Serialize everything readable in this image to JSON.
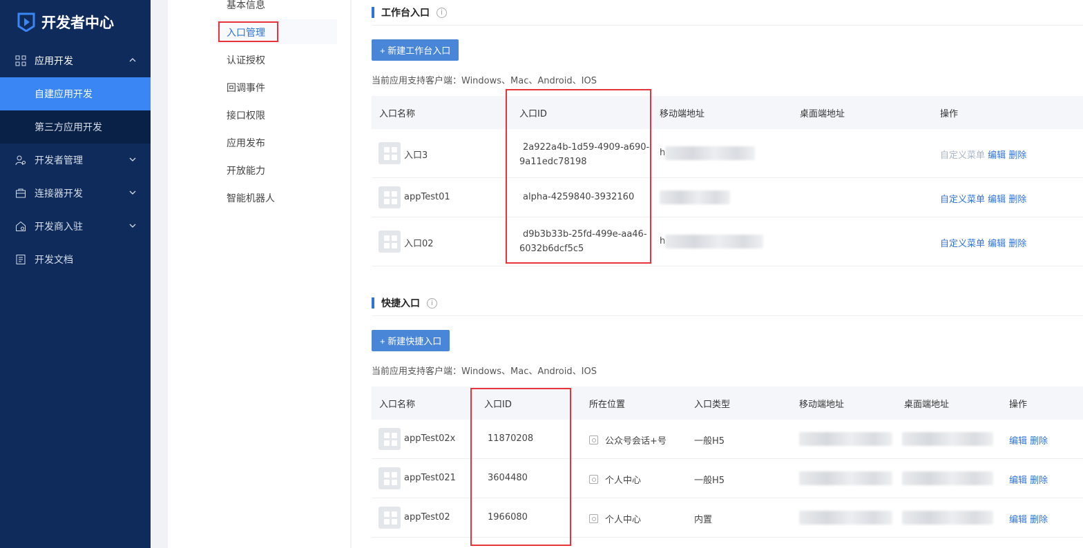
{
  "brand": {
    "name": "开发者中心"
  },
  "sidebar": {
    "items": [
      {
        "label": "应用开发",
        "icon": "grid-icon",
        "expanded": true,
        "children": [
          {
            "label": "自建应用开发",
            "active": true
          },
          {
            "label": "第三方应用开发",
            "active": false
          }
        ]
      },
      {
        "label": "开发者管理",
        "icon": "developer-gear-icon"
      },
      {
        "label": "连接器开发",
        "icon": "connector-icon"
      },
      {
        "label": "开发商入驻",
        "icon": "home-shop-icon"
      },
      {
        "label": "开发文档",
        "icon": "document-icon"
      }
    ]
  },
  "midmenu": {
    "items": [
      "基本信息",
      "入口管理",
      "认证授权",
      "回调事件",
      "接口权限",
      "应用发布",
      "开放能力",
      "智能机器人"
    ],
    "active": "入口管理"
  },
  "workbench": {
    "title": "工作台入口",
    "new_button": "+ 新建工作台入口",
    "support_text": "当前应用支持客户端：Windows、Mac、Android、IOS",
    "columns": [
      "入口名称",
      "入口ID",
      "移动端地址",
      "桌面端地址",
      "操作"
    ],
    "rows": [
      {
        "name": "入口3",
        "id_line1": "2a922a4b-1d59-4909-a690-",
        "id_line2": "9a11edc78198",
        "mobile_prefix": "h",
        "actions": [
          "自定义菜单",
          "编辑",
          "删除"
        ],
        "custom_menu_disabled": true
      },
      {
        "name": "appTest01",
        "id_line1": "alpha-4259840-3932160",
        "id_line2": "",
        "mobile_prefix": "",
        "actions": [
          "自定义菜单",
          "编辑",
          "删除"
        ],
        "custom_menu_disabled": false
      },
      {
        "name": "入口02",
        "id_line1": "d9b3b33b-25fd-499e-aa46-",
        "id_line2": "6032b6dcf5c5",
        "mobile_prefix": "h",
        "actions": [
          "自定义菜单",
          "编辑",
          "删除"
        ],
        "custom_menu_disabled": false
      }
    ]
  },
  "shortcut": {
    "title": "快捷入口",
    "new_button": "+ 新建快捷入口",
    "support_text": "当前应用支持客户端：Windows、Mac、Android、IOS",
    "columns": [
      "入口名称",
      "入口ID",
      "所在位置",
      "入口类型",
      "移动端地址",
      "桌面端地址",
      "操作"
    ],
    "rows": [
      {
        "name": "appTest02x",
        "id": "11870208",
        "position": "公众号会话+号",
        "type": "一般H5",
        "actions": [
          "编辑",
          "删除"
        ]
      },
      {
        "name": "appTest021",
        "id": "3604480",
        "position": "个人中心",
        "type": "一般H5",
        "actions": [
          "编辑",
          "删除"
        ]
      },
      {
        "name": "appTest02",
        "id": "1966080",
        "position": "个人中心",
        "type": "内置",
        "actions": [
          "编辑",
          "删除"
        ]
      }
    ]
  },
  "colors": {
    "sidebar_bg": "#0f2b5b",
    "active_blue": "#3a86f5",
    "link_blue": "#2f73d9",
    "highlight_red": "#e8333d"
  }
}
